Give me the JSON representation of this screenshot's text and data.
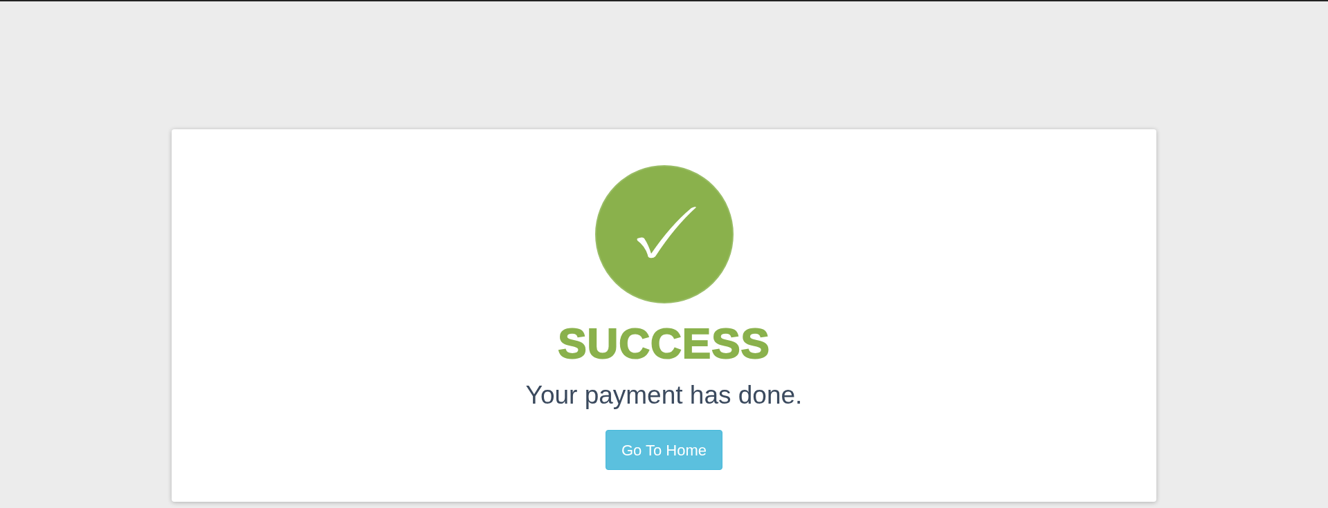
{
  "card": {
    "title": "SUCCESS",
    "message": "Your payment has done.",
    "button": "Go To Home"
  }
}
